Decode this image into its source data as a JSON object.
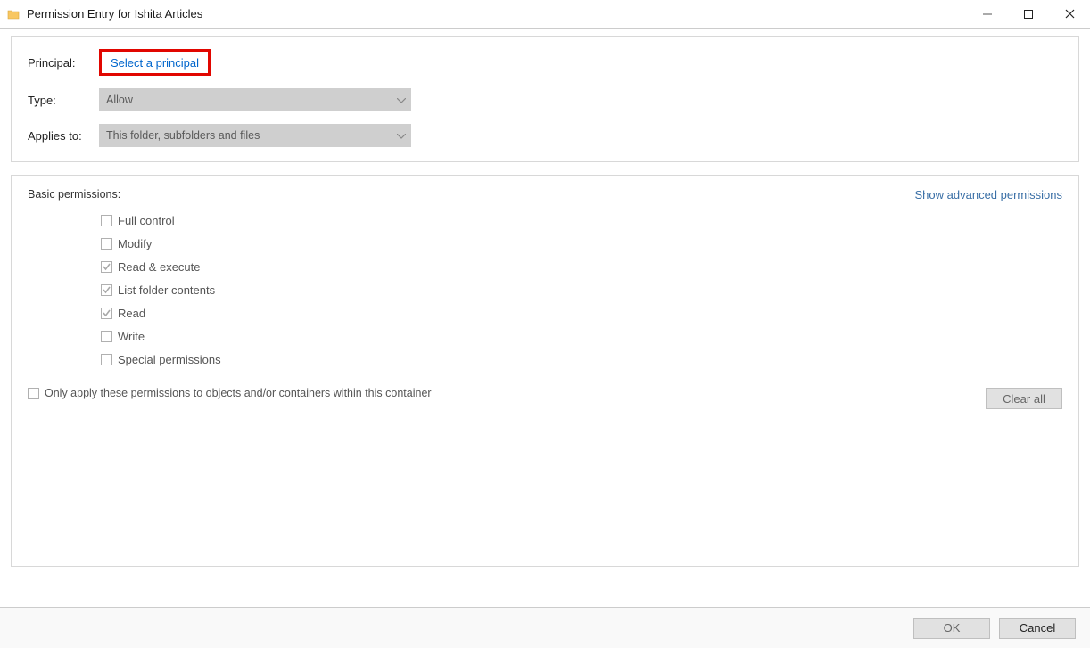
{
  "window": {
    "title": "Permission Entry for Ishita Articles"
  },
  "form": {
    "principal_label": "Principal:",
    "principal_link": "Select a principal",
    "type_label": "Type:",
    "type_value": "Allow",
    "applies_label": "Applies to:",
    "applies_value": "This folder, subfolders and files"
  },
  "permissions": {
    "heading": "Basic permissions:",
    "advanced_link": "Show advanced permissions",
    "items": [
      {
        "label": "Full control",
        "checked": false
      },
      {
        "label": "Modify",
        "checked": false
      },
      {
        "label": "Read & execute",
        "checked": true
      },
      {
        "label": "List folder contents",
        "checked": true
      },
      {
        "label": "Read",
        "checked": true
      },
      {
        "label": "Write",
        "checked": false
      },
      {
        "label": "Special permissions",
        "checked": false
      }
    ],
    "only_apply_label": "Only apply these permissions to objects and/or containers within this container",
    "clear_all": "Clear all"
  },
  "footer": {
    "ok": "OK",
    "cancel": "Cancel"
  }
}
